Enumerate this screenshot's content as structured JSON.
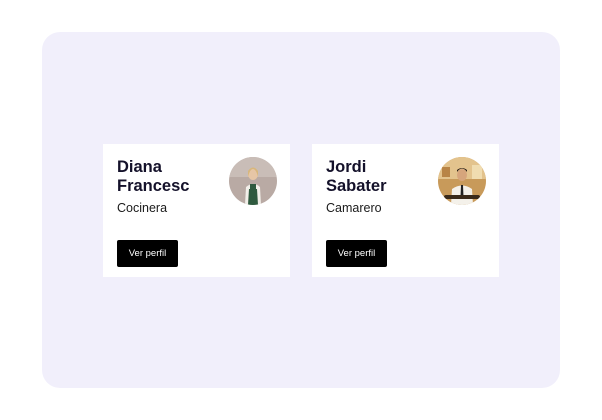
{
  "cards": [
    {
      "name": "Diana Francesc",
      "role": "Cocinera",
      "button_label": "Ver perfil",
      "avatar_icon": "woman-in-apron-photo"
    },
    {
      "name": "Jordi Sabater",
      "role": "Camarero",
      "button_label": "Ver perfil",
      "avatar_icon": "waiter-photo"
    }
  ],
  "colors": {
    "panel_background": "#f1effb",
    "card_background": "#ffffff",
    "button_background": "#000000",
    "name_text": "#14112a"
  }
}
